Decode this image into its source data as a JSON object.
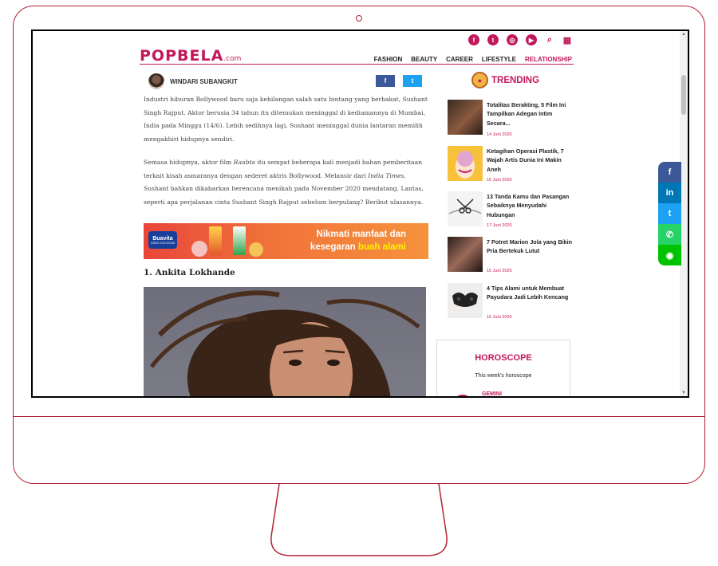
{
  "site": {
    "logo_text": "POPBELA",
    "logo_suffix": ".com"
  },
  "header": {
    "social_icons": [
      "facebook-icon",
      "twitter-icon",
      "instagram-icon",
      "youtube-icon",
      "search-icon",
      "grid-menu-icon"
    ],
    "nav": [
      "FASHION",
      "BEAUTY",
      "CAREER",
      "LIFESTYLE",
      "RELATIONSHIP"
    ],
    "active_nav": "RELATIONSHIP"
  },
  "article": {
    "author": "WINDARI SUBANGKIT",
    "share_facebook": "f",
    "share_twitter": "t",
    "paragraph1": "Industri hiburan Bollywood baru saja kehilangan salah satu bintang yang berbakat, Sushant Singh Rajput. Aktor berusia 34 tahun itu ditemukan meninggal di kediamannya di Mumbai, India pada Minggu (14/6). Lebih sedihnya lagi, Sushant meninggal dunia lantaran memilih mengakhiri hidupnya sendiri.",
    "paragraph2_a": "Semasa hidupnya, aktor film ",
    "paragraph2_b": "Raabta",
    "paragraph2_c": " itu sempat beberapa kali menjadi bahan pemberitaan terkait kisah asmaranya dengan sederet aktris Bollywood. Melansir dari ",
    "paragraph2_d": "India Times",
    "paragraph2_e": ", Sushant bahkan dikabarkan berencana menikah pada November 2020 mendatang. Lantas, seperti apa perjalanan cinta Sushant Singh Rajput sebelum berpulang? Berikut ulasannya.",
    "section_title": "1. Ankita Lokhande"
  },
  "banner": {
    "brand": "Buavita",
    "brand_tag": "GOES YOU GOOD",
    "line1": "Nikmati manfaat dan",
    "line2_a": "kesegaran ",
    "line2_b": "buah alami"
  },
  "trending": {
    "title": "TRENDING",
    "items": [
      {
        "title": "Totalitas Berakting, 5 Film Ini Tampilkan Adegan Intim Secara...",
        "date": "14 Juni 2020"
      },
      {
        "title": "Ketagihan Operasi Plastik, 7 Wajah Artis Dunia Ini Makin Aneh",
        "date": "16 Juni 2020"
      },
      {
        "title": "13 Tanda Kamu dan Pasangan Sebaiknya Menyudahi Hubungan",
        "date": "17 Juni 2020"
      },
      {
        "title": "7 Potret Marion Jola yang Bikin Pria Bertekuk Lutut",
        "date": "15 Juni 2020"
      },
      {
        "title": "4 Tips Alami untuk Membuat Payudara Jadi Lebih Kencang",
        "date": "16 Juni 2020"
      }
    ]
  },
  "horoscope": {
    "title": "HOROSCOPE",
    "subtitle": "This week's horoscope",
    "sign": "GEMINI"
  },
  "side_share": [
    {
      "icon": "facebook-icon",
      "color": "#3b5998"
    },
    {
      "icon": "linkedin-icon",
      "color": "#0077b5"
    },
    {
      "icon": "twitter-icon",
      "color": "#1da1f2"
    },
    {
      "icon": "whatsapp-icon",
      "color": "#25d366"
    },
    {
      "icon": "line-icon",
      "color": "#00c300"
    }
  ]
}
